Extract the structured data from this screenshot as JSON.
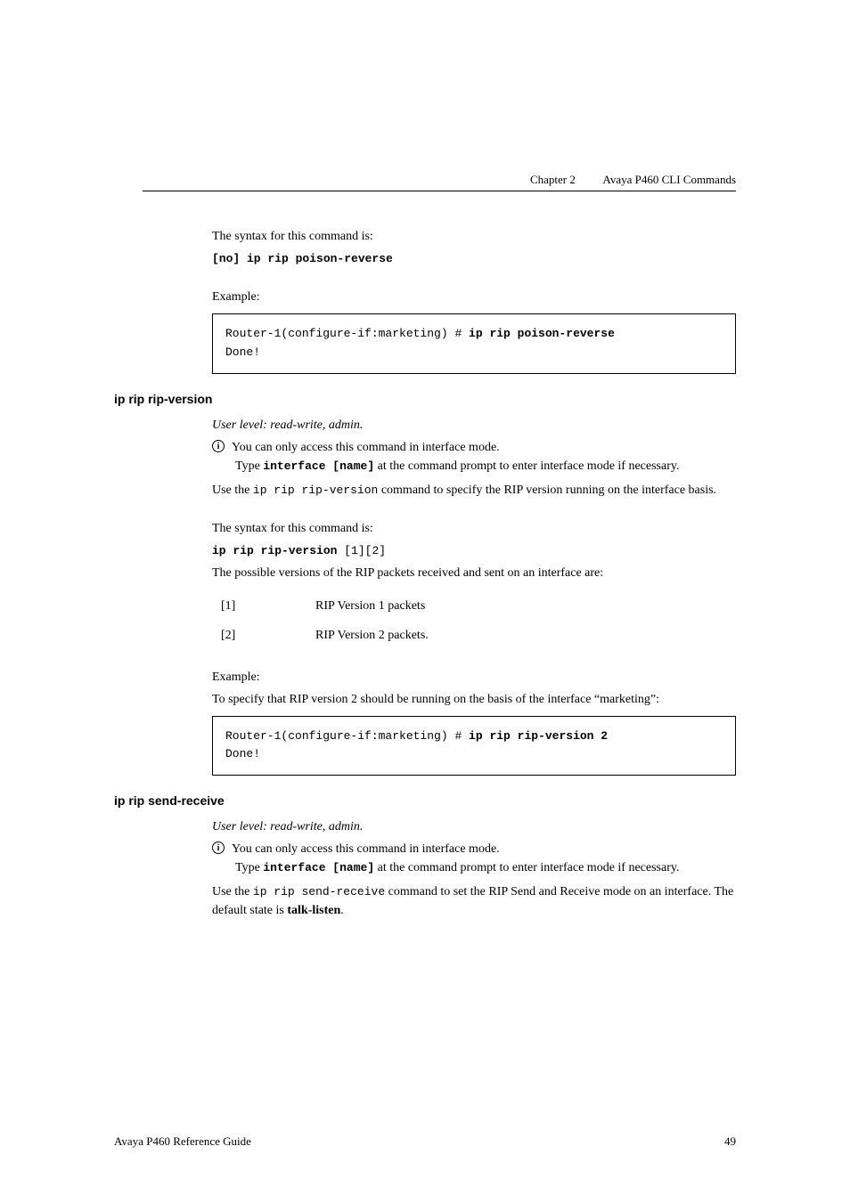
{
  "header": {
    "chapter": "Chapter 2",
    "title": "Avaya P460 CLI Commands"
  },
  "section1": {
    "syntax_intro": "The syntax for this command is:",
    "syntax_cmd": "[no] ip rip poison-reverse",
    "example_label": "Example:",
    "code_prompt": "Router-1(configure-if:marketing) # ",
    "code_cmd": "ip rip poison-reverse",
    "code_result": "Done!"
  },
  "section2": {
    "heading": "ip rip rip-version",
    "user_level": "User level: read-write, admin.",
    "note_line1": "You can only access this command in interface mode.",
    "note_line2a": "Type ",
    "note_line2b": "interface [name]",
    "note_line2c": " at the command prompt to enter interface mode if necessary.",
    "desc_a": "Use the ",
    "desc_cmd": "ip rip rip-version",
    "desc_b": " command to specify the RIP version running on the interface basis.",
    "syntax_intro": "The syntax for this command is:",
    "syntax_cmd": "ip rip rip-version",
    "syntax_args": " [1][2]",
    "versions_intro": "The possible versions of the RIP packets received and sent on an interface are:",
    "versions": [
      {
        "key": "[1]",
        "desc": "RIP Version 1 packets"
      },
      {
        "key": "[2]",
        "desc": "RIP Version 2 packets."
      }
    ],
    "example_label": "Example:",
    "example_desc": "To specify that RIP version 2 should be running on the basis of the interface “marketing”:",
    "code_prompt": "Router-1(configure-if:marketing) # ",
    "code_cmd": "ip rip rip-version 2",
    "code_result": "Done!"
  },
  "section3": {
    "heading": "ip rip send-receive",
    "user_level": "User level: read-write, admin.",
    "note_line1": "You can only access this command in interface mode.",
    "note_line2a": "Type ",
    "note_line2b": "interface [name]",
    "note_line2c": " at the command prompt to enter interface mode if necessary.",
    "desc_a": "Use the ",
    "desc_cmd": "ip rip send-receive",
    "desc_b": " command to set the RIP Send and Receive mode on an interface. The default state is ",
    "desc_bold": "talk-listen",
    "desc_c": "."
  },
  "footer": {
    "left": "Avaya P460 Reference Guide",
    "page": "49"
  },
  "icon_glyph": "i"
}
